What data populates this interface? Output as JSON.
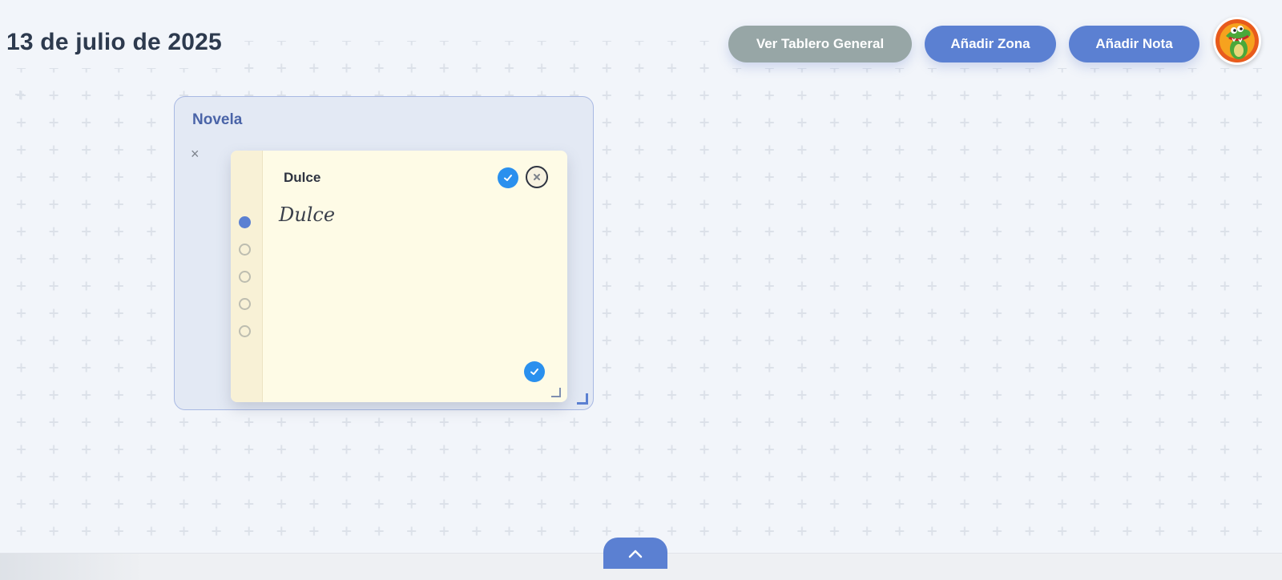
{
  "header": {
    "date_title": "13 de julio de 2025",
    "buttons": {
      "general_board": "Ver Tablero General",
      "add_zone": "Añadir Zona",
      "add_note": "Añadir Nota"
    },
    "avatar_icon": "crocodile-avatar-icon"
  },
  "zone": {
    "title": "Novela",
    "close_symbol": "×"
  },
  "note": {
    "title": "Dulce",
    "body": "Dulce",
    "dots": [
      {
        "active": true
      },
      {
        "active": false
      },
      {
        "active": false
      },
      {
        "active": false
      },
      {
        "active": false
      }
    ]
  },
  "colors": {
    "accent": "#5b80d2",
    "gray_button": "#97a6a6",
    "check": "#2a90ee",
    "note_bg": "#fefbe6",
    "zone_bg": "#e3e9f4",
    "title_text": "#2d3a4e"
  }
}
